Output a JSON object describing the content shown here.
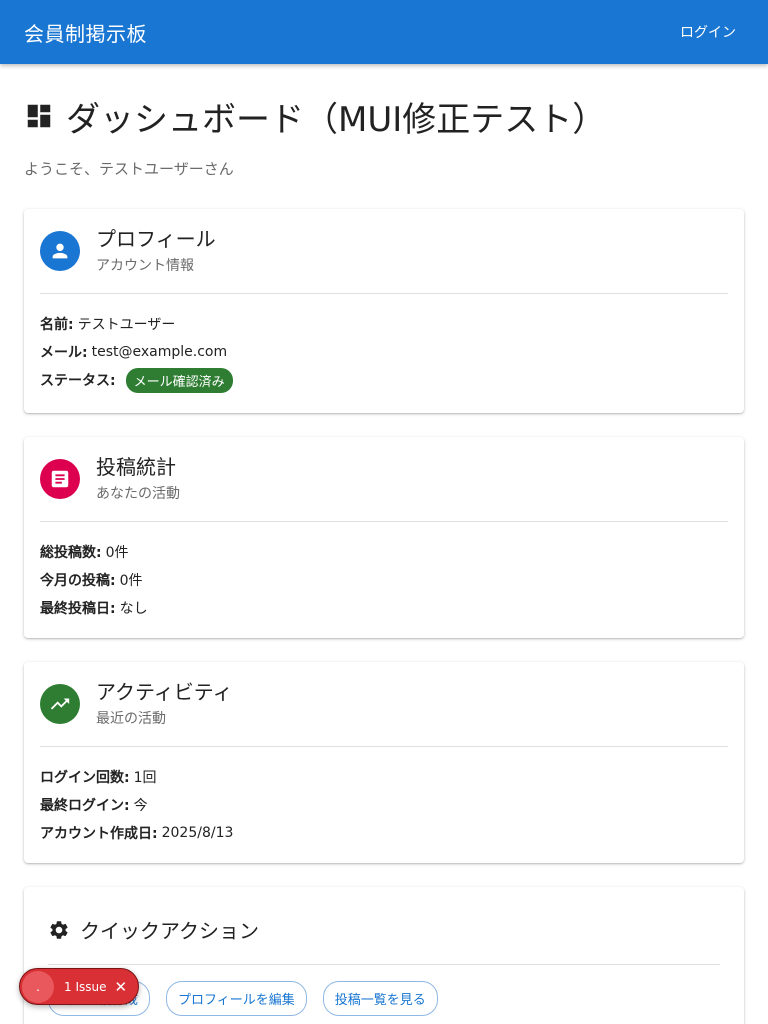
{
  "appbar": {
    "title": "会員制掲示板",
    "login_label": "ログイン"
  },
  "page": {
    "title": "ダッシュボード（MUI修正テスト）",
    "welcome": "ようこそ、テストユーザーさん"
  },
  "cards": {
    "profile": {
      "title": "プロフィール",
      "subtitle": "アカウント情報",
      "avatar_color": "#1976d2",
      "rows": [
        {
          "label": "名前:",
          "value": "テストユーザー"
        },
        {
          "label": "メール:",
          "value": "test@example.com"
        },
        {
          "label": "ステータス:",
          "chip": "メール確認済み"
        }
      ]
    },
    "stats": {
      "title": "投稿統計",
      "subtitle": "あなたの活動",
      "avatar_color": "#dc004e",
      "rows": [
        {
          "label": "総投稿数:",
          "value": "0件"
        },
        {
          "label": "今月の投稿:",
          "value": "0件"
        },
        {
          "label": "最終投稿日:",
          "value": "なし"
        }
      ]
    },
    "activity": {
      "title": "アクティビティ",
      "subtitle": "最近の活動",
      "avatar_color": "#2e7d32",
      "rows": [
        {
          "label": "ログイン回数:",
          "value": "1回"
        },
        {
          "label": "最終ログイン:",
          "value": "今"
        },
        {
          "label": "アカウント作成日:",
          "value": "2025/8/13"
        }
      ]
    }
  },
  "quick_actions": {
    "title": "クイックアクション",
    "buttons": [
      "新規投稿作成",
      "プロフィールを編集",
      "投稿一覧を見る"
    ]
  },
  "issue_badge": {
    "dot": ".",
    "label": "1 Issue",
    "close": "✕"
  },
  "colors": {
    "primary": "#1976d2",
    "secondary": "#dc004e",
    "success": "#2e7d32",
    "error": "#d93036"
  },
  "icons": [
    "dashboard-icon",
    "person-icon",
    "article-icon",
    "trending-up-icon",
    "gear-icon",
    "close-icon"
  ]
}
